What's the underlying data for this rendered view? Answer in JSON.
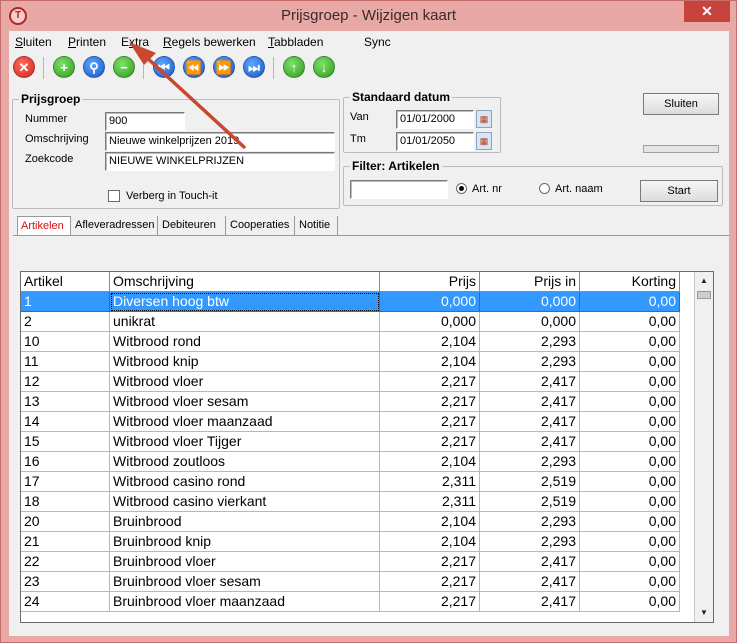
{
  "window": {
    "title": "Prijsgroep - Wijzigen kaart",
    "close_symbol": "✕",
    "icon": "app-logo-icon"
  },
  "menu": [
    "Sluiten",
    "Printen",
    "Extra",
    "Regels bewerken",
    "Tabbladen",
    "Sync"
  ],
  "menu_underline": [
    "S",
    "P",
    "x",
    "R",
    "T",
    ""
  ],
  "toolbar": [
    {
      "name": "close-record-icon",
      "glyph": "✕",
      "color": "red"
    },
    {
      "name": "add-icon",
      "glyph": "+",
      "color": "green"
    },
    {
      "name": "search-icon",
      "glyph": "⚲",
      "color": "blue"
    },
    {
      "name": "delete-icon",
      "glyph": "−",
      "color": "green"
    },
    {
      "name": "first-record-icon",
      "glyph": "⏮",
      "color": "blue"
    },
    {
      "name": "previous-record-icon",
      "glyph": "⏪",
      "color": "blue"
    },
    {
      "name": "next-record-icon",
      "glyph": "⏩",
      "color": "blue"
    },
    {
      "name": "last-record-icon",
      "glyph": "⏭",
      "color": "blue"
    },
    {
      "name": "move-up-icon",
      "glyph": "↑",
      "color": "green"
    },
    {
      "name": "move-down-icon",
      "glyph": "↓",
      "color": "green"
    }
  ],
  "prijsgroep": {
    "title": "Prijsgroep",
    "nummer_label": "Nummer",
    "nummer_value": "900",
    "omschrijving_label": "Omschrijving",
    "omschrijving_value": "Nieuwe winkelprijzen 2019",
    "zoekcode_label": "Zoekcode",
    "zoekcode_value": "NIEUWE WINKELPRIJZEN",
    "touchit_label": "Verberg in Touch-it"
  },
  "standaard_datum": {
    "title": "Standaard datum",
    "van_label": "Van",
    "van_value": "01/01/2000",
    "tm_label": "Tm",
    "tm_value": "01/01/2050"
  },
  "buttons": {
    "sluiten": "Sluiten",
    "start": "Start"
  },
  "filter": {
    "title": "Filter: Artikelen",
    "value": "",
    "option_artnr": "Art. nr",
    "option_artnaam": "Art. naam",
    "selected": "Art. nr"
  },
  "tabs": [
    "Artikelen",
    "Afleveradressen",
    "Debiteuren",
    "Cooperaties",
    "Notitie"
  ],
  "active_tab": "Artikelen",
  "table": {
    "columns": [
      "Artikel",
      "Omschrijving",
      "Prijs",
      "Prijs in",
      "Korting"
    ],
    "rows": [
      [
        "1",
        "Diversen hoog btw",
        "0,000",
        "0,000",
        "0,00"
      ],
      [
        "2",
        "unikrat",
        "0,000",
        "0,000",
        "0,00"
      ],
      [
        "10",
        "Witbrood rond",
        "2,104",
        "2,293",
        "0,00"
      ],
      [
        "11",
        "Witbrood knip",
        "2,104",
        "2,293",
        "0,00"
      ],
      [
        "12",
        "Witbrood vloer",
        "2,217",
        "2,417",
        "0,00"
      ],
      [
        "13",
        "Witbrood vloer sesam",
        "2,217",
        "2,417",
        "0,00"
      ],
      [
        "14",
        "Witbrood vloer maanzaad",
        "2,217",
        "2,417",
        "0,00"
      ],
      [
        "15",
        "Witbrood vloer Tijger",
        "2,217",
        "2,417",
        "0,00"
      ],
      [
        "16",
        "Witbrood zoutloos",
        "2,104",
        "2,293",
        "0,00"
      ],
      [
        "17",
        "Witbrood casino rond",
        "2,311",
        "2,519",
        "0,00"
      ],
      [
        "18",
        "Witbrood casino vierkant",
        "2,311",
        "2,519",
        "0,00"
      ],
      [
        "20",
        "Bruinbrood",
        "2,104",
        "2,293",
        "0,00"
      ],
      [
        "21",
        "Bruinbrood knip",
        "2,104",
        "2,293",
        "0,00"
      ],
      [
        "22",
        "Bruinbrood vloer",
        "2,217",
        "2,417",
        "0,00"
      ],
      [
        "23",
        "Bruinbrood vloer sesam",
        "2,217",
        "2,417",
        "0,00"
      ],
      [
        "24",
        "Bruinbrood vloer maanzaad",
        "2,217",
        "2,417",
        "0,00"
      ]
    ],
    "selected_row": 0
  },
  "colors": {
    "title_bg": "#e8a9a6",
    "close_bg": "#c7443c",
    "selection": "#3399ff",
    "annotation_arrow": "#c8472e",
    "active_tab_text": "#d01010"
  }
}
